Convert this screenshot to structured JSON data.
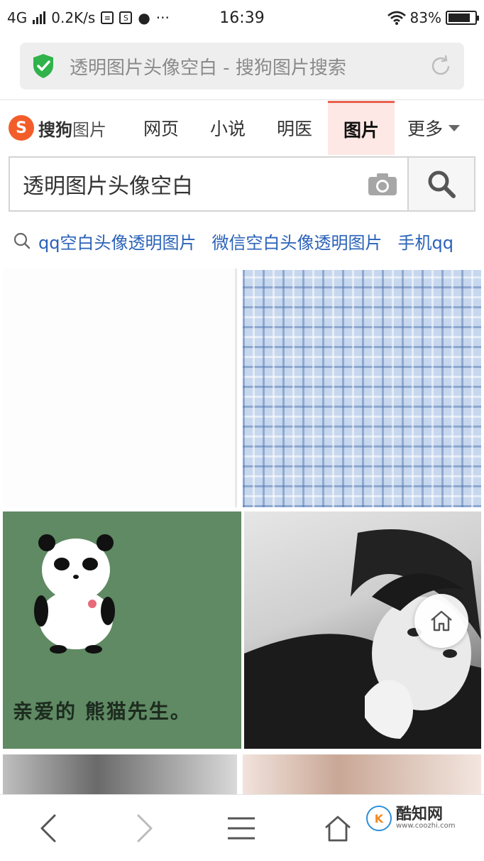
{
  "status_bar": {
    "network": "4G",
    "speed": "0.2K/s",
    "time": "16:39",
    "battery": "83%",
    "battery_level": 0.83,
    "more": "···"
  },
  "url_bar": {
    "title": "透明图片头像空白 - 搜狗图片搜索"
  },
  "tabs": {
    "logo_brand": "搜狗",
    "logo_sub": "图片",
    "items": [
      {
        "label": "网页"
      },
      {
        "label": "小说"
      },
      {
        "label": "明医"
      },
      {
        "label": "图片"
      }
    ],
    "more_label": "更多"
  },
  "search": {
    "query": "透明图片头像空白"
  },
  "suggestions": [
    "qq空白头像透明图片",
    "微信空白头像透明图片",
    "手机qq"
  ],
  "images": {
    "panda_caption": "亲爱的 熊猫先生。"
  },
  "watermark": {
    "logo": "K",
    "name": "酷知网",
    "url": "www.coozhi.com"
  },
  "icons": {
    "shield": "shield-check-icon",
    "reload": "reload-icon",
    "camera": "camera-icon",
    "search": "search-icon",
    "back": "back-arrow-icon",
    "forward": "forward-arrow-icon",
    "menu": "menu-icon",
    "home": "home-icon"
  },
  "colors": {
    "accent": "#e8624f",
    "shield": "#2fb34a",
    "link": "#2a62b8",
    "logo": "#f35d2a"
  }
}
